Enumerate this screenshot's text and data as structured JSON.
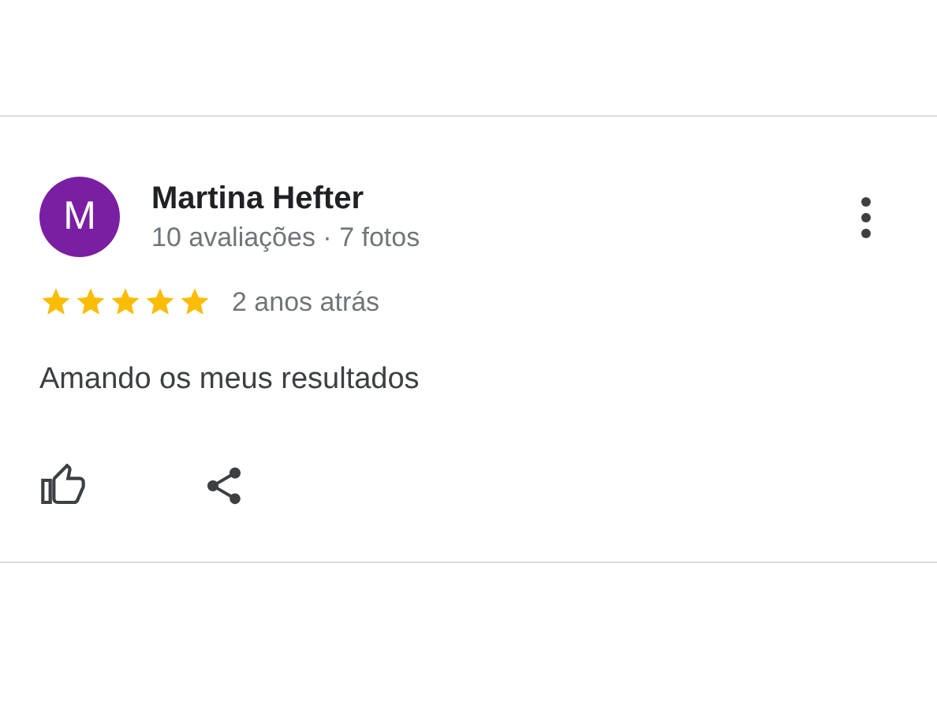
{
  "review": {
    "avatar_letter": "M",
    "author": "Martina Hefter",
    "author_stats": "10 avaliações · 7 fotos",
    "stars": 5,
    "time": "2 anos atrás",
    "text": "Amando os meus resultados"
  }
}
